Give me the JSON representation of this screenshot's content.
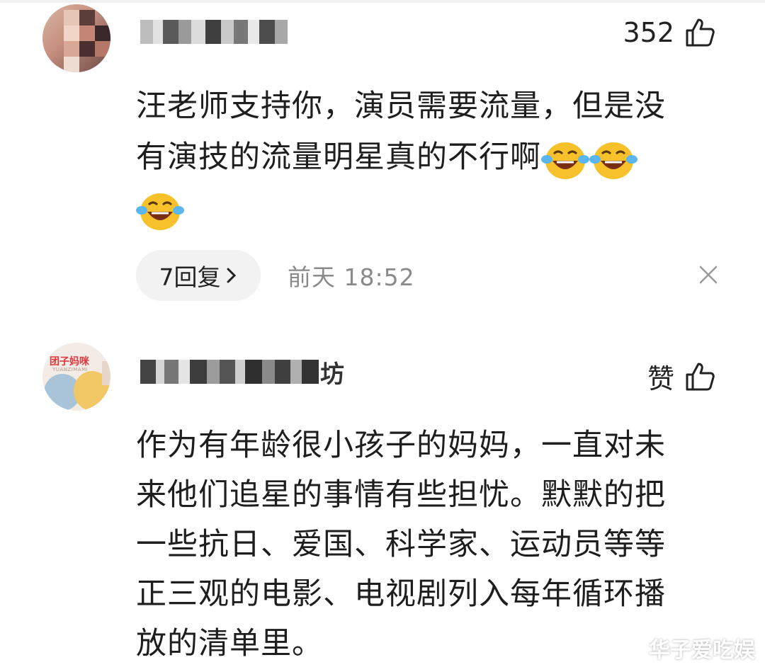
{
  "comments": [
    {
      "likes": "352",
      "text_line1": "汪老师支持你，演员需要流量，但是没",
      "text_line2": "有演技的流量明星真的不行啊",
      "emoji": [
        "crying-laughing",
        "crying-laughing",
        "crying-laughing"
      ],
      "reply_label": "7回复",
      "time": "前天  18:52"
    },
    {
      "likes": "赞",
      "avatar_text": "团子妈咪",
      "avatar_subtext": "YUANZIMAMI",
      "username_partial": "坊",
      "text_lines": [
        "作为有年龄很小孩子的妈妈，一直对未",
        "来他们追星的事情有些担忧。默默的把",
        "一些抗日、爱国、科学家、运动员等等",
        "正三观的电影、电视剧列入每年循环播",
        "放的清单里。"
      ]
    }
  ],
  "watermark": "华子爱吃娱",
  "colors": {
    "accent_emoji": "#f7c12b",
    "pill_bg": "#f2f2f2",
    "muted": "#8a8a8a"
  }
}
